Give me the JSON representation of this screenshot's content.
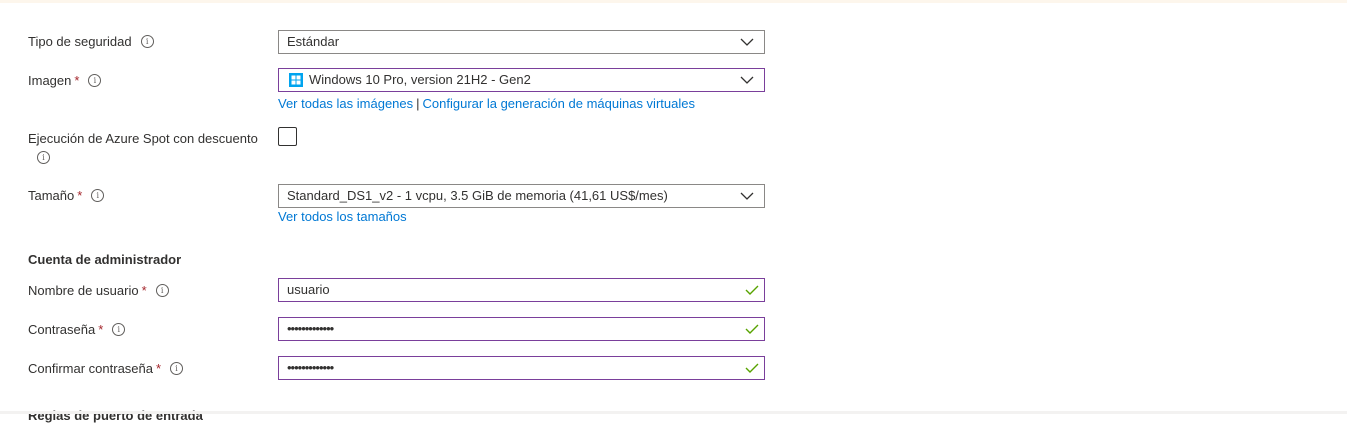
{
  "security": {
    "label": "Tipo de seguridad",
    "value": "Estándar"
  },
  "image": {
    "label": "Imagen",
    "required": "*",
    "value": "Windows 10 Pro, version 21H2 - Gen2",
    "link_all": "Ver todas las imágenes",
    "separator": "|",
    "link_config": "Configurar la generación de máquinas virtuales"
  },
  "spot": {
    "label": "Ejecución de Azure Spot con descuento",
    "checked": false
  },
  "size": {
    "label": "Tamaño",
    "required": "*",
    "value": "Standard_DS1_v2 - 1 vcpu, 3.5 GiB de memoria (41,61 US$/mes)",
    "link_all": "Ver todos los tamaños"
  },
  "admin": {
    "heading": "Cuenta de administrador",
    "username": {
      "label": "Nombre de usuario",
      "required": "*",
      "value": "usuario"
    },
    "password": {
      "label": "Contraseña",
      "required": "*",
      "value": "•••••••••••••"
    },
    "confirm": {
      "label": "Confirmar contraseña",
      "required": "*",
      "value": "•••••••••••••"
    }
  },
  "next_section_heading": "Reglas de puerto de entrada",
  "icons": {
    "info": "info-icon",
    "chevron": "chevron-down-icon",
    "check": "checkmark-icon",
    "windows": "windows-logo-icon"
  },
  "colors": {
    "required": "#a4262c",
    "link": "#0078d4",
    "focus_border": "#7a3f9b",
    "valid_check": "#57a300",
    "windows_blue": "#00a4ef"
  }
}
